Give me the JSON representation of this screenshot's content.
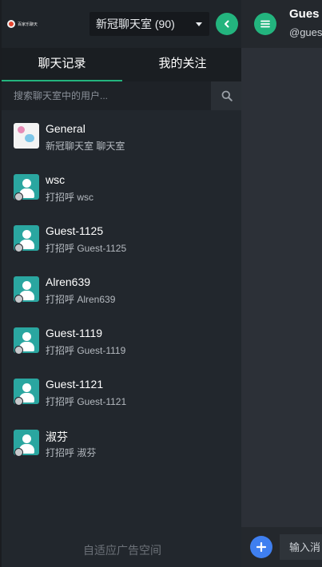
{
  "header": {
    "logo_text": "百家乐聊天",
    "room_select": "新冠聊天室 (90)"
  },
  "tabs": [
    {
      "label": "聊天记录",
      "active": true
    },
    {
      "label": "我的关注",
      "active": false
    }
  ],
  "search": {
    "placeholder": "搜索聊天室中的用户..."
  },
  "list": [
    {
      "name": "General",
      "sub": "新冠聊天室 聊天室",
      "avatar": "room-image"
    },
    {
      "name": "wsc",
      "sub": "打招呼 wsc",
      "avatar": "user-icon"
    },
    {
      "name": "Guest-1125",
      "sub": "打招呼 Guest-1125",
      "avatar": "user-icon"
    },
    {
      "name": "Alren639",
      "sub": "打招呼 Alren639",
      "avatar": "user-icon"
    },
    {
      "name": "Guest-1119",
      "sub": "打招呼 Guest-1119",
      "avatar": "user-icon"
    },
    {
      "name": "Guest-1121",
      "sub": "打招呼 Guest-1121",
      "avatar": "user-icon"
    },
    {
      "name": "淑芬",
      "sub": "打招呼 淑芬",
      "avatar": "user-icon"
    }
  ],
  "ad": "自适应广告空间",
  "chat": {
    "title": "Gues",
    "subtitle": "@gues",
    "input_placeholder": "输入消"
  },
  "colors": {
    "accent": "#23b47e",
    "add_button": "#3f7ff0",
    "sidebar_bg": "#22272d"
  }
}
